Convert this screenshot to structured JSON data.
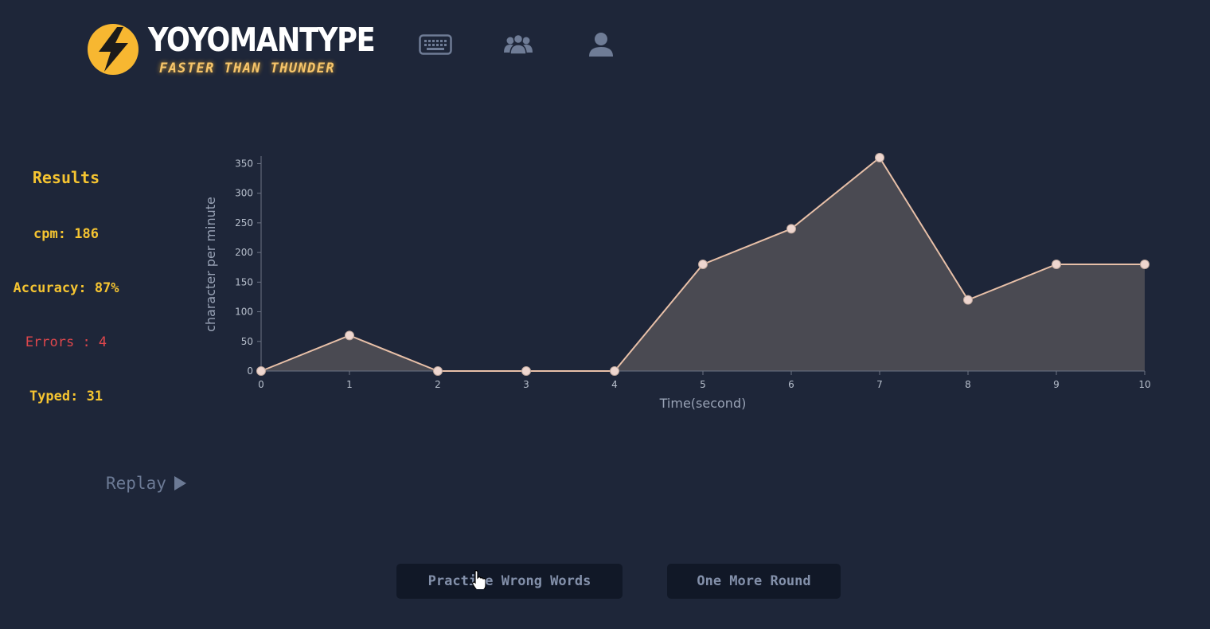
{
  "header": {
    "brand_name": "YOYOMANTYPE",
    "tagline": "FASTER THAN THUNDER",
    "nav_icons": [
      "keyboard-icon",
      "group-icon",
      "user-icon"
    ]
  },
  "results": {
    "title": "Results",
    "cpm": "cpm: 186",
    "accuracy": "Accuracy: 87%",
    "errors": "Errors : 4",
    "typed": "Typed: 31"
  },
  "replay": {
    "label": "Replay"
  },
  "chart_data": {
    "type": "area",
    "x": [
      0,
      1,
      2,
      3,
      4,
      5,
      6,
      7,
      8,
      9,
      10
    ],
    "series": [
      {
        "values": [
          0,
          60,
          0,
          0,
          0,
          180,
          240,
          360,
          120,
          180,
          180
        ]
      }
    ],
    "xlabel": "Time(second)",
    "ylabel": "character per minute",
    "xlim": [
      0,
      10
    ],
    "ylim": [
      0,
      360
    ],
    "yticks": [
      0,
      50,
      100,
      150,
      200,
      250,
      300,
      350
    ],
    "xticks": [
      0,
      1,
      2,
      3,
      4,
      5,
      6,
      7,
      8,
      9,
      10
    ],
    "grid": false,
    "colors": {
      "line": "#e8c0a8",
      "fill": "#4a4a52",
      "point": "#eed6cf",
      "axis": "#6c7384"
    }
  },
  "actions": {
    "practice_label": "Practice Wrong Words",
    "one_more_label": "One More Round"
  },
  "colors": {
    "background": "#1e2639",
    "accent": "#f5c431",
    "error": "#e0474c",
    "button_bg": "#111827",
    "muted": "#6c7a95"
  }
}
